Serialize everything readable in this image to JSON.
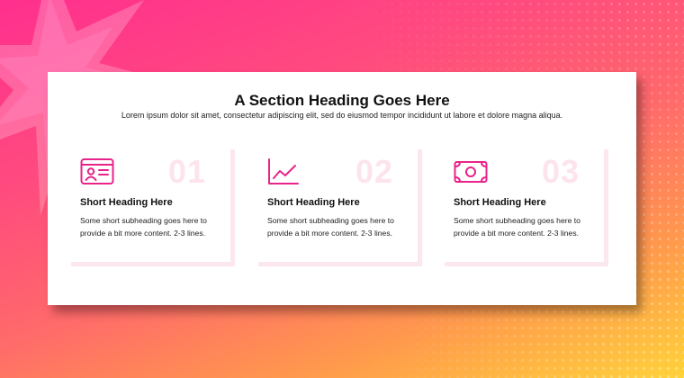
{
  "section": {
    "title": "A Section Heading Goes Here",
    "subtitle": "Lorem ipsum dolor sit amet, consectetur adipiscing elit, sed do eiusmod tempor incididunt ut labore et dolore magna aliqua."
  },
  "features": [
    {
      "number": "01",
      "icon": "id-card-icon",
      "heading": "Short Heading Here",
      "text": "Some short subheading goes here to provide a bit more content. 2-3 lines."
    },
    {
      "number": "02",
      "icon": "line-chart-icon",
      "heading": "Short Heading Here",
      "text": "Some short subheading goes here to provide a bit more content. 2-3 lines."
    },
    {
      "number": "03",
      "icon": "banknote-icon",
      "heading": "Short Heading Here",
      "text": "Some short subheading goes here to provide a bit more content. 2-3 lines."
    }
  ],
  "colors": {
    "accent": "#e8238a",
    "number_tint": "#fde4ec"
  }
}
